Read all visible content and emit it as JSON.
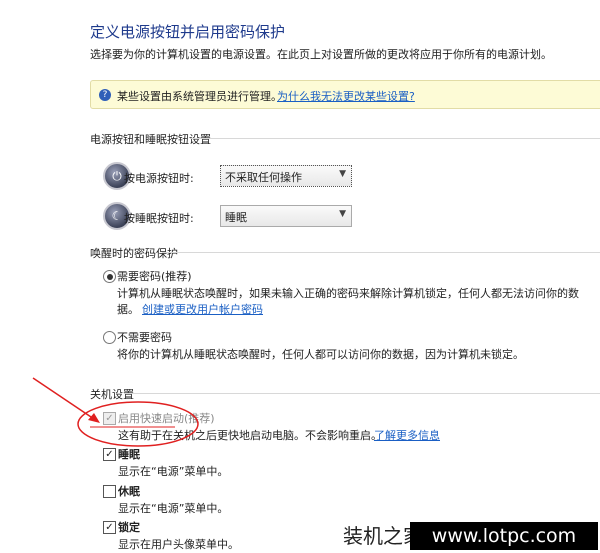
{
  "title": "定义电源按钮并启用密码保护",
  "subtitle": "选择要为你的计算机设置的电源设置。在此页上对设置所做的更改将应用于你所有的电源计划。",
  "info_bar": {
    "icon": "question-icon",
    "text": "某些设置由系统管理员进行管理。",
    "link": "为什么我无法更改某些设置?"
  },
  "power_section": {
    "heading": "电源按钮和睡眠按钮设置",
    "power_label": "按电源按钮时:",
    "power_value": "不采取任何操作",
    "sleep_label": "按睡眠按钮时:",
    "sleep_value": "睡眠"
  },
  "wake_section": {
    "heading": "唤醒时的密码保护",
    "opt1_label": "需要密码(推荐)",
    "opt1_desc1": "计算机从睡眠状态唤醒时，如果未输入正确的密码来解除计算机锁定，任何人都无法访问你的数",
    "opt1_desc2": "据。",
    "opt1_link": "创建或更改用户帐户密码",
    "opt2_label": "不需要密码",
    "opt2_desc": "将你的计算机从睡眠状态唤醒时，任何人都可以访问你的数据，因为计算机未锁定。"
  },
  "shutdown_section": {
    "heading": "关机设置",
    "items": [
      {
        "label": "启用快速启动(推荐)",
        "desc": "这有助于在关机之后更快地启动电脑。不会影响重启。",
        "link": "了解更多信息",
        "checked": true,
        "disabled": true
      },
      {
        "label": "睡眠",
        "desc": "显示在“电源”菜单中。",
        "checked": true
      },
      {
        "label": "休眠",
        "desc": "显示在“电源”菜单中。",
        "checked": false
      },
      {
        "label": "锁定",
        "desc": "显示在用户头像菜单中。",
        "checked": true
      }
    ]
  },
  "watermark": {
    "text": "装机之家",
    "url": "www.lotpc.com"
  },
  "colors": {
    "title": "#1e3a8c",
    "link": "#1a5fc4",
    "annotation": "#e02020"
  }
}
